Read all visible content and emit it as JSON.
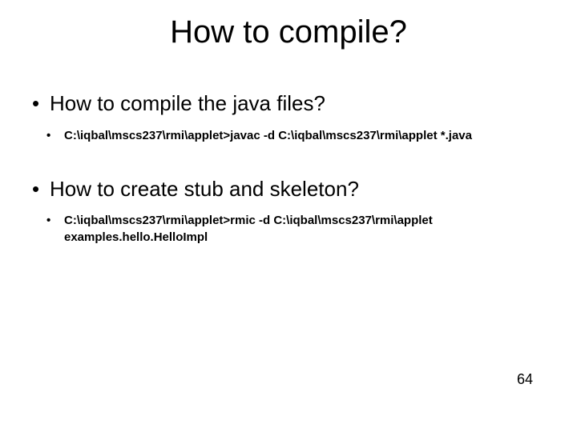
{
  "title": "How to compile?",
  "bullets": {
    "q1": "How to compile the java files?",
    "cmd1": "C:\\iqbal\\mscs237\\rmi\\applet>javac -d C:\\iqbal\\mscs237\\rmi\\applet   *.java",
    "q2": "How to create stub and skeleton?",
    "cmd2a": "C:\\iqbal\\mscs237\\rmi\\applet>rmic  -d C:\\iqbal\\mscs237\\rmi\\applet",
    "cmd2b": "examples.hello.HelloImpl"
  },
  "page_number": "64"
}
